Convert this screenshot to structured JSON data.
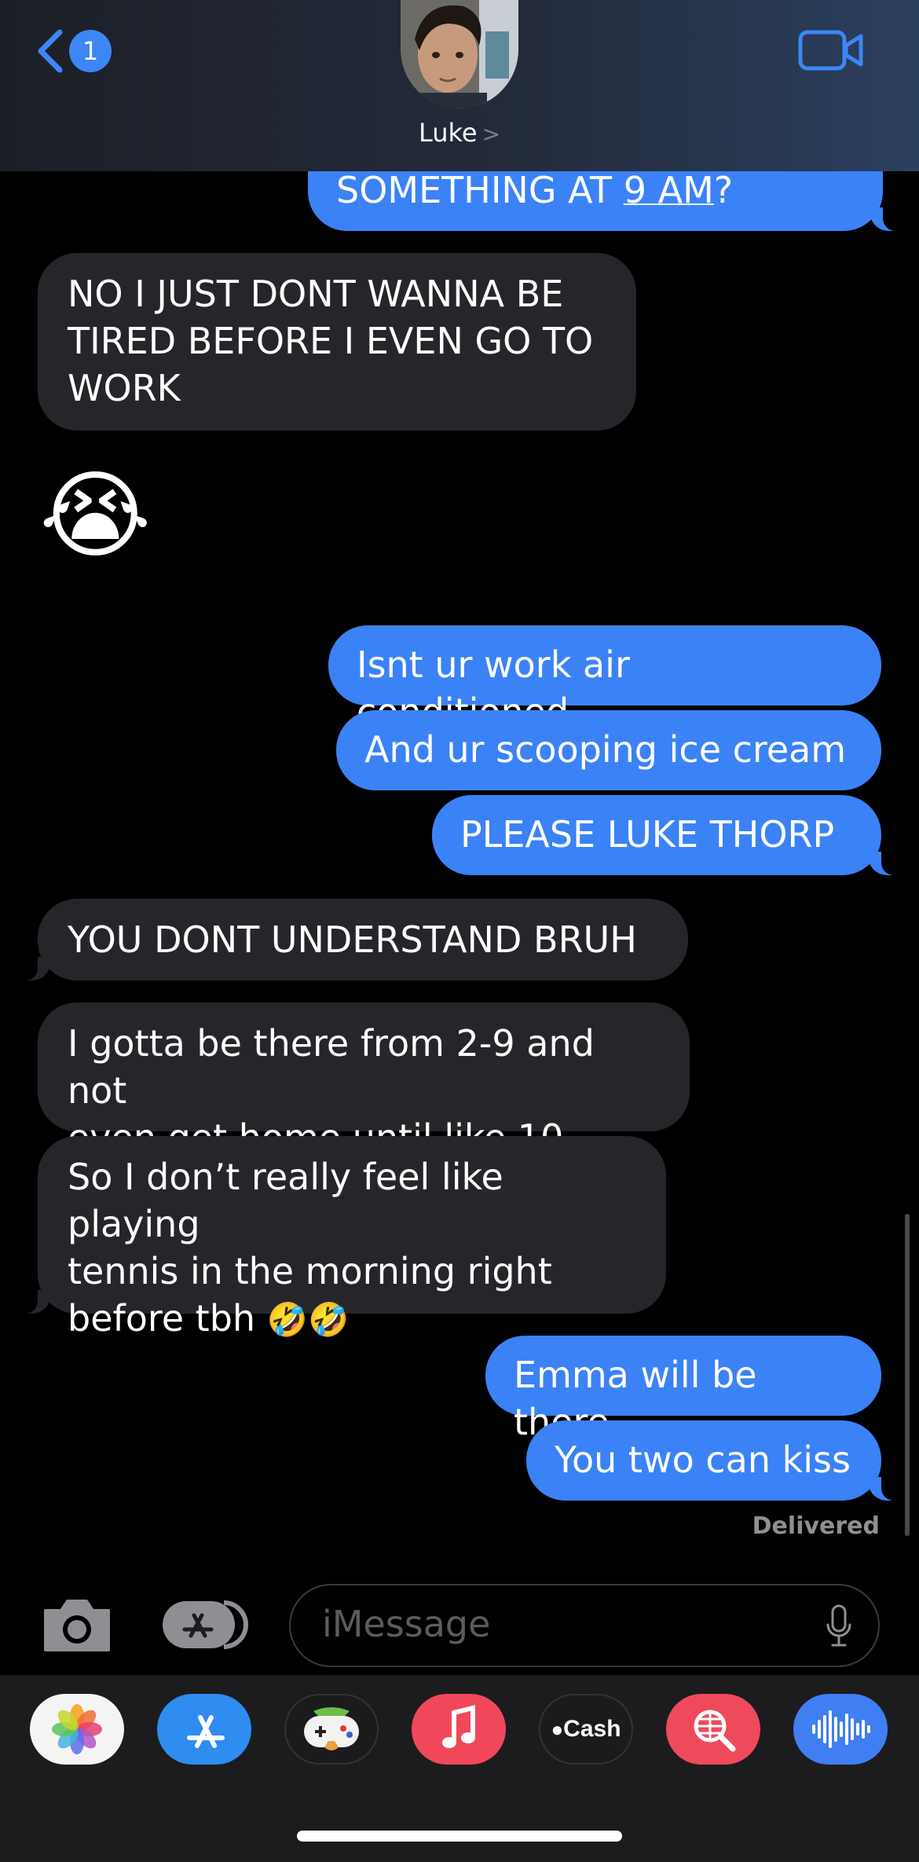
{
  "header": {
    "back_count": "1",
    "contact_name": "Luke",
    "contact_chevron": ">"
  },
  "messages": [
    {
      "id": "m0",
      "dir": "out",
      "parts": [
        "SOMETHING AT ",
        "9 AM",
        "?"
      ]
    },
    {
      "id": "m1",
      "dir": "in",
      "lines": [
        "NO I JUST DONT WANNA BE",
        "TIRED BEFORE I EVEN GO TO",
        "WORK"
      ]
    },
    {
      "id": "m2",
      "dir": "in",
      "emoji": "😭"
    },
    {
      "id": "m3",
      "dir": "out",
      "text": "Isnt ur work air conditioned"
    },
    {
      "id": "m4",
      "dir": "out",
      "text": "And ur scooping ice cream"
    },
    {
      "id": "m5",
      "dir": "out",
      "text": "PLEASE LUKE THORP"
    },
    {
      "id": "m6",
      "dir": "in",
      "text": "YOU DONT UNDERSTAND BRUH"
    },
    {
      "id": "m7",
      "dir": "in",
      "lines": [
        "I gotta be there from 2-9 and not",
        "even get home until like 10"
      ]
    },
    {
      "id": "m8",
      "dir": "in",
      "lines": [
        "So I don’t really feel like playing",
        "tennis in the morning right",
        "before tbh"
      ],
      "emoji_suffix": "🤣🤣"
    },
    {
      "id": "m9",
      "dir": "out",
      "text": "Emma will be there"
    },
    {
      "id": "m10",
      "dir": "out",
      "text": "You two can kiss"
    }
  ],
  "status": "Delivered",
  "composer": {
    "placeholder": "iMessage"
  },
  "app_drawer": [
    {
      "name": "Photos",
      "icon": "photos-icon"
    },
    {
      "name": "App Store",
      "icon": "app-store-icon"
    },
    {
      "name": "Game",
      "icon": "game-controller-icon"
    },
    {
      "name": "Music",
      "icon": "music-note-icon"
    },
    {
      "name": "Cash",
      "label": "Cash",
      "icon": "apple-cash-icon"
    },
    {
      "name": "Search",
      "icon": "globe-search-icon"
    },
    {
      "name": "Audio",
      "icon": "audio-waveform-icon"
    }
  ],
  "colors": {
    "outgoing": "#3b82f6",
    "incoming": "#26262a",
    "accent": "#3d86f5"
  }
}
